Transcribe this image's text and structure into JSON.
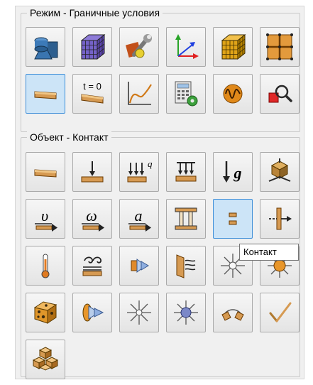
{
  "mode_group": {
    "title": "Режим - Граничные условия",
    "buttons": [
      {
        "name": "geometry-shapes-icon",
        "active": false
      },
      {
        "name": "mesh-cube-icon",
        "active": false
      },
      {
        "name": "tools-wrench-icon",
        "active": false
      },
      {
        "name": "axes-icon",
        "active": false
      },
      {
        "name": "mesh-cube-gold-icon",
        "active": false
      },
      {
        "name": "grid-nodes-icon",
        "active": false
      },
      {
        "name": "boundary-conditions-icon",
        "active": true
      },
      {
        "name": "initial-conditions-icon",
        "text": "t = 0",
        "active": false
      },
      {
        "name": "curve-plot-icon",
        "active": false
      },
      {
        "name": "calculator-settings-icon",
        "active": false
      },
      {
        "name": "waveform-icon",
        "active": false
      },
      {
        "name": "magnify-results-icon",
        "active": false
      }
    ]
  },
  "object_group": {
    "title": "Объект - Контакт",
    "buttons": [
      {
        "name": "body-icon"
      },
      {
        "name": "force-icon"
      },
      {
        "name": "distributed-load-icon",
        "text": "q"
      },
      {
        "name": "pressure-icon"
      },
      {
        "name": "gravity-icon",
        "text": "g"
      },
      {
        "name": "support-icon"
      },
      {
        "name": "velocity-icon",
        "text": "υ"
      },
      {
        "name": "angular-velocity-icon",
        "text": "ω"
      },
      {
        "name": "acceleration-icon",
        "text": "a"
      },
      {
        "name": "pillar-icon"
      },
      {
        "name": "contact-icon",
        "active": true
      },
      {
        "name": "joint-icon"
      },
      {
        "name": "thermometer-icon"
      },
      {
        "name": "convection-icon"
      },
      {
        "name": "heat-flux-icon"
      },
      {
        "name": "radiation-wall-icon"
      },
      {
        "name": "light-star-icon"
      },
      {
        "name": "sun-icon"
      },
      {
        "name": "heat-source-cube-icon"
      },
      {
        "name": "flux-cylinder-icon"
      },
      {
        "name": "point-source-star-icon"
      },
      {
        "name": "point-source-sun-icon"
      },
      {
        "name": "connector-icon"
      },
      {
        "name": "check-tool-icon"
      },
      {
        "name": "assembly-cubes-icon"
      }
    ]
  },
  "tooltip": {
    "text": "Контакт"
  }
}
